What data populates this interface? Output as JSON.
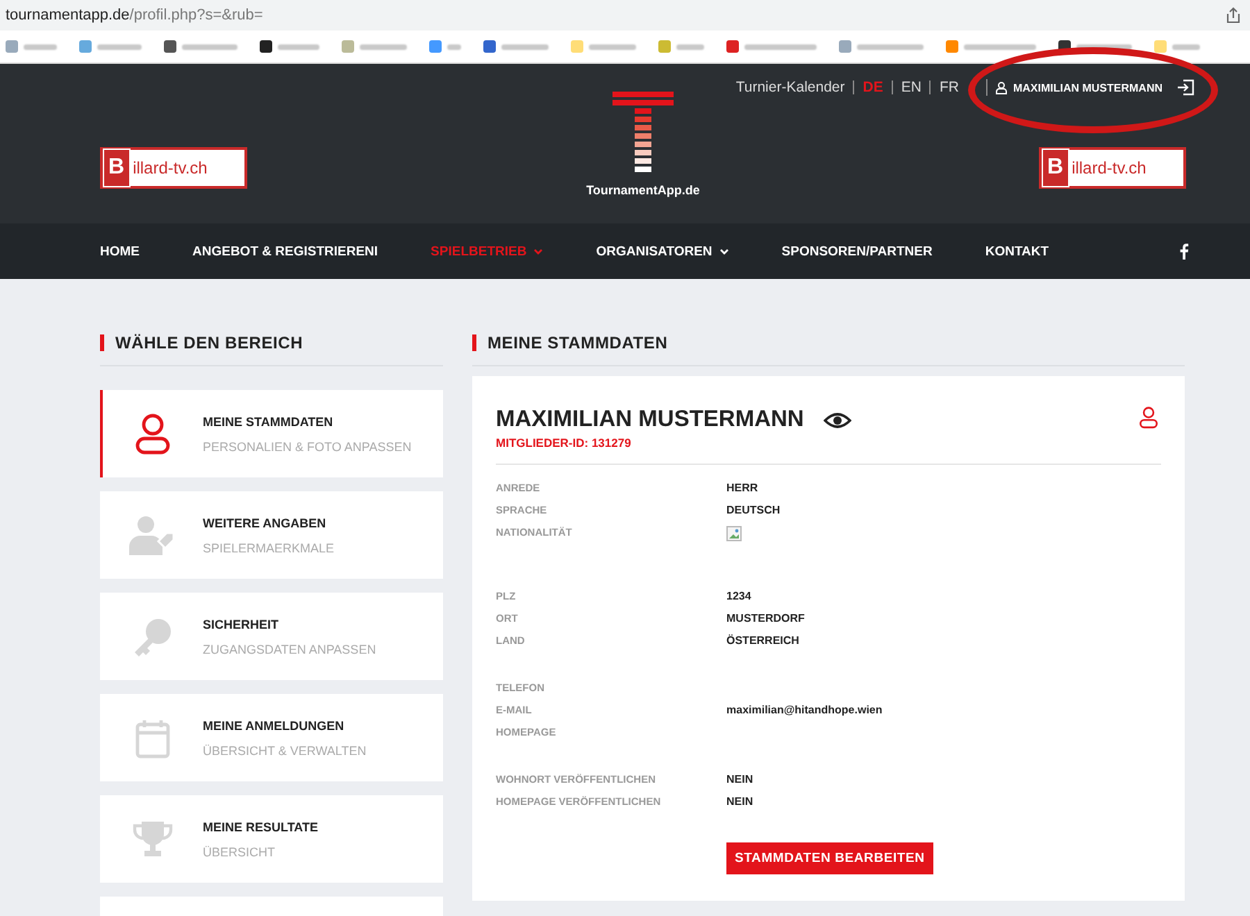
{
  "browser": {
    "url_host": "tournamentapp.de",
    "url_path": "/profil.php?s=&rub="
  },
  "header": {
    "links": [
      {
        "label": "Turnier-Kalender",
        "selected": false
      },
      {
        "label": "DE",
        "selected": true
      },
      {
        "label": "EN",
        "selected": false
      },
      {
        "label": "FR",
        "selected": false
      }
    ],
    "user": "MAXIMILIAN MUSTERMANN",
    "logo_text": "TournamentApp.de",
    "sponsors": [
      {
        "letter": "B",
        "rest": "illard-tv.ch"
      },
      {
        "letter": "B",
        "rest": "illard-tv.ch"
      }
    ]
  },
  "nav": [
    {
      "label": "HOME",
      "selected": false,
      "dropdown": false
    },
    {
      "label": "ANGEBOT & REGISTRIERENI",
      "selected": false,
      "dropdown": false
    },
    {
      "label": "SPIELBETRIEB",
      "selected": true,
      "dropdown": true
    },
    {
      "label": "ORGANISATOREN",
      "selected": false,
      "dropdown": true
    },
    {
      "label": "SPONSOREN/PARTNER",
      "selected": false,
      "dropdown": false
    },
    {
      "label": "KONTAKT",
      "selected": false,
      "dropdown": false
    }
  ],
  "sidebar": {
    "title": "WÄHLE DEN BEREICH",
    "items": [
      {
        "title": "MEINE STAMMDATEN",
        "subtitle": "PERSONALIEN & FOTO ANPASSEN",
        "selected": true
      },
      {
        "title": "WEITERE ANGABEN",
        "subtitle": "SPIELERMAERKMALE",
        "selected": false
      },
      {
        "title": "SICHERHEIT",
        "subtitle": "ZUGANGSDATEN ANPASSEN",
        "selected": false
      },
      {
        "title": "MEINE ANMELDUNGEN",
        "subtitle": "ÜBERSICHT & VERWALTEN",
        "selected": false
      },
      {
        "title": "MEINE RESULTATE",
        "subtitle": "ÜBERSICHT",
        "selected": false
      }
    ]
  },
  "main": {
    "title": "MEINE STAMMDATEN",
    "name": "MAXIMILIAN MUSTERMANN",
    "member_id": "MITGLIEDER-ID: 131279",
    "groups": [
      [
        {
          "label": "ANREDE",
          "kind": "text",
          "value": "HERR"
        },
        {
          "label": "SPRACHE",
          "kind": "text",
          "value": "DEUTSCH"
        },
        {
          "label": "NATIONALITÄT",
          "kind": "flag"
        }
      ],
      [
        {
          "label": "PLZ",
          "kind": "text",
          "value": "1234"
        },
        {
          "label": "ORT",
          "kind": "text",
          "value": "MUSTERDORF"
        },
        {
          "label": "LAND",
          "kind": "text",
          "value": "ÖSTERREICH"
        }
      ],
      [
        {
          "label": "TELEFON",
          "kind": "empty"
        },
        {
          "label": "E-MAIL",
          "kind": "text",
          "value": "maximilian@hitandhope.wien"
        },
        {
          "label": "HOMEPAGE",
          "kind": "empty"
        }
      ],
      [
        {
          "label": "WOHNORT VERÖFFENTLICHEN",
          "kind": "text",
          "value": "NEIN"
        },
        {
          "label": "HOMEPAGE VERÖFFENTLICHEN",
          "kind": "text",
          "value": "NEIN"
        }
      ]
    ],
    "edit_button": "STAMMDATEN BEARBEITEN"
  }
}
